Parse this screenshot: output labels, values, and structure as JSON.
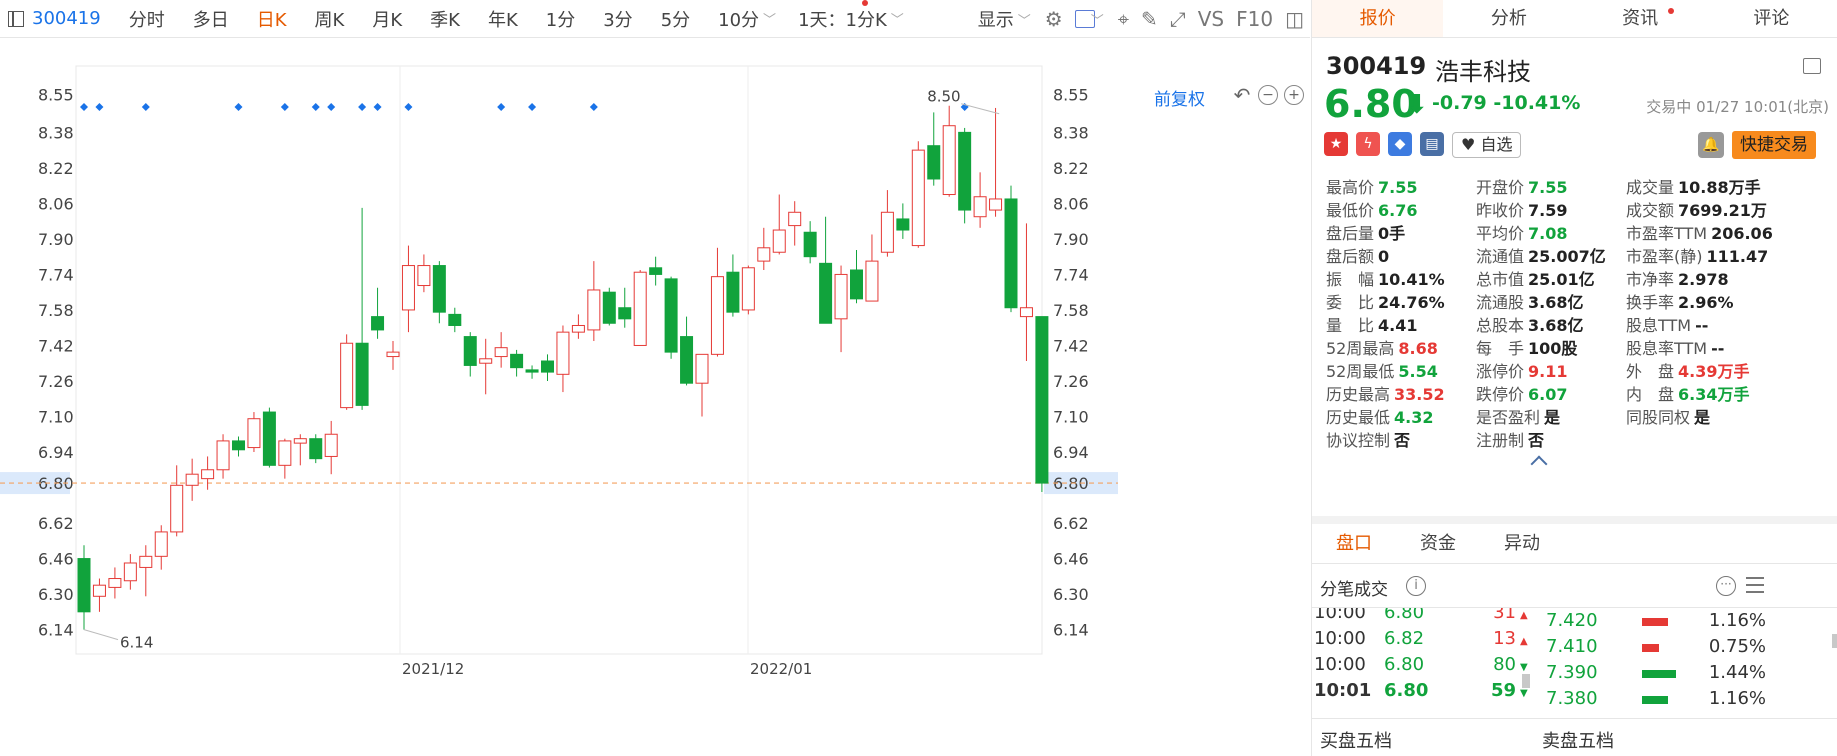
{
  "toolbar": {
    "code": "300419",
    "tabs": [
      "分时",
      "多日",
      "日K",
      "周K",
      "月K",
      "季K",
      "年K",
      "1分",
      "3分",
      "5分",
      "10分"
    ],
    "active_tab": "日K",
    "period_select": "1天：1分K",
    "display_label": "显示",
    "vs_label": "VS",
    "f10_label": "F10"
  },
  "chart_header": {
    "adjust_label": "前复权"
  },
  "chart_data": {
    "type": "candlestick",
    "y_ticks": [
      8.55,
      8.38,
      8.22,
      8.06,
      7.9,
      7.74,
      7.58,
      7.42,
      7.26,
      7.1,
      6.94,
      6.8,
      6.62,
      6.46,
      6.3,
      6.14
    ],
    "y_ticks_labels": [
      "8.55",
      "8.38",
      "8.22",
      "8.06",
      "7.90",
      "7.74",
      "7.58",
      "7.42",
      "7.26",
      "7.10",
      "6.94",
      "6.80",
      "6.62",
      "6.46",
      "6.30",
      "6.14"
    ],
    "ylim": [
      6.03,
      8.67
    ],
    "x_labels": [
      "2021/12",
      "2022/01"
    ],
    "current_price": 6.8,
    "current_price_label": "6.80",
    "max_annotation": {
      "value": 8.5,
      "label": "8.50"
    },
    "min_annotation": {
      "value": 6.14,
      "label": "6.14"
    },
    "candles": [
      {
        "o": 6.46,
        "h": 6.52,
        "l": 6.14,
        "c": 6.22
      },
      {
        "o": 6.29,
        "h": 6.37,
        "l": 6.22,
        "c": 6.34
      },
      {
        "o": 6.33,
        "h": 6.42,
        "l": 6.28,
        "c": 6.37
      },
      {
        "o": 6.36,
        "h": 6.48,
        "l": 6.32,
        "c": 6.44
      },
      {
        "o": 6.42,
        "h": 6.52,
        "l": 6.29,
        "c": 6.47
      },
      {
        "o": 6.47,
        "h": 6.61,
        "l": 6.41,
        "c": 6.58
      },
      {
        "o": 6.58,
        "h": 6.88,
        "l": 6.56,
        "c": 6.79
      },
      {
        "o": 6.79,
        "h": 6.91,
        "l": 6.72,
        "c": 6.84
      },
      {
        "o": 6.82,
        "h": 6.92,
        "l": 6.77,
        "c": 6.86
      },
      {
        "o": 6.86,
        "h": 7.02,
        "l": 6.82,
        "c": 6.99
      },
      {
        "o": 6.99,
        "h": 7.01,
        "l": 6.92,
        "c": 6.95
      },
      {
        "o": 6.96,
        "h": 7.12,
        "l": 6.94,
        "c": 7.09
      },
      {
        "o": 7.12,
        "h": 7.14,
        "l": 6.87,
        "c": 6.88
      },
      {
        "o": 6.88,
        "h": 7.0,
        "l": 6.82,
        "c": 6.99
      },
      {
        "o": 6.98,
        "h": 7.02,
        "l": 6.88,
        "c": 7.0
      },
      {
        "o": 7.0,
        "h": 7.02,
        "l": 6.89,
        "c": 6.91
      },
      {
        "o": 6.92,
        "h": 7.08,
        "l": 6.84,
        "c": 7.02
      },
      {
        "o": 7.14,
        "h": 7.47,
        "l": 7.13,
        "c": 7.43
      },
      {
        "o": 7.43,
        "h": 8.04,
        "l": 7.13,
        "c": 7.15
      },
      {
        "o": 7.55,
        "h": 7.68,
        "l": 7.45,
        "c": 7.49
      },
      {
        "o": 7.37,
        "h": 7.44,
        "l": 7.31,
        "c": 7.39
      },
      {
        "o": 7.58,
        "h": 7.87,
        "l": 7.48,
        "c": 7.78
      },
      {
        "o": 7.69,
        "h": 7.83,
        "l": 7.66,
        "c": 7.78
      },
      {
        "o": 7.78,
        "h": 7.8,
        "l": 7.52,
        "c": 7.57
      },
      {
        "o": 7.56,
        "h": 7.59,
        "l": 7.48,
        "c": 7.51
      },
      {
        "o": 7.46,
        "h": 7.48,
        "l": 7.28,
        "c": 7.33
      },
      {
        "o": 7.34,
        "h": 7.45,
        "l": 7.2,
        "c": 7.36
      },
      {
        "o": 7.37,
        "h": 7.48,
        "l": 7.32,
        "c": 7.41
      },
      {
        "o": 7.38,
        "h": 7.4,
        "l": 7.28,
        "c": 7.32
      },
      {
        "o": 7.31,
        "h": 7.33,
        "l": 7.27,
        "c": 7.3
      },
      {
        "o": 7.35,
        "h": 7.38,
        "l": 7.26,
        "c": 7.3
      },
      {
        "o": 7.29,
        "h": 7.51,
        "l": 7.21,
        "c": 7.48
      },
      {
        "o": 7.48,
        "h": 7.56,
        "l": 7.45,
        "c": 7.51
      },
      {
        "o": 7.49,
        "h": 7.8,
        "l": 7.44,
        "c": 7.67
      },
      {
        "o": 7.66,
        "h": 7.68,
        "l": 7.51,
        "c": 7.52
      },
      {
        "o": 7.59,
        "h": 7.68,
        "l": 7.5,
        "c": 7.54
      },
      {
        "o": 7.42,
        "h": 7.76,
        "l": 7.42,
        "c": 7.75
      },
      {
        "o": 7.77,
        "h": 7.82,
        "l": 7.69,
        "c": 7.74
      },
      {
        "o": 7.72,
        "h": 7.73,
        "l": 7.36,
        "c": 7.39
      },
      {
        "o": 7.46,
        "h": 7.55,
        "l": 7.24,
        "c": 7.25
      },
      {
        "o": 7.25,
        "h": 7.35,
        "l": 7.1,
        "c": 7.38
      },
      {
        "o": 7.38,
        "h": 7.86,
        "l": 7.37,
        "c": 7.73
      },
      {
        "o": 7.75,
        "h": 7.83,
        "l": 7.55,
        "c": 7.57
      },
      {
        "o": 7.58,
        "h": 7.78,
        "l": 7.56,
        "c": 7.77
      },
      {
        "o": 7.8,
        "h": 7.95,
        "l": 7.76,
        "c": 7.86
      },
      {
        "o": 7.84,
        "h": 8.1,
        "l": 7.83,
        "c": 7.94
      },
      {
        "o": 7.96,
        "h": 8.07,
        "l": 7.87,
        "c": 8.02
      },
      {
        "o": 7.93,
        "h": 7.98,
        "l": 7.79,
        "c": 7.82
      },
      {
        "o": 7.79,
        "h": 8.0,
        "l": 7.55,
        "c": 7.52
      },
      {
        "o": 7.54,
        "h": 7.78,
        "l": 7.39,
        "c": 7.74
      },
      {
        "o": 7.76,
        "h": 7.85,
        "l": 7.61,
        "c": 7.63
      },
      {
        "o": 7.62,
        "h": 7.92,
        "l": 7.62,
        "c": 7.8
      },
      {
        "o": 7.84,
        "h": 8.12,
        "l": 7.82,
        "c": 8.02
      },
      {
        "o": 7.99,
        "h": 8.06,
        "l": 7.9,
        "c": 7.94
      },
      {
        "o": 7.87,
        "h": 8.34,
        "l": 7.86,
        "c": 8.3
      },
      {
        "o": 8.32,
        "h": 8.47,
        "l": 8.14,
        "c": 8.17
      },
      {
        "o": 8.1,
        "h": 8.5,
        "l": 8.09,
        "c": 8.41
      },
      {
        "o": 8.38,
        "h": 8.4,
        "l": 7.97,
        "c": 8.03
      },
      {
        "o": 8.0,
        "h": 8.2,
        "l": 7.95,
        "c": 8.09
      },
      {
        "o": 8.03,
        "h": 8.49,
        "l": 8.0,
        "c": 8.08
      },
      {
        "o": 8.08,
        "h": 8.14,
        "l": 7.57,
        "c": 7.59
      },
      {
        "o": 7.55,
        "h": 7.97,
        "l": 7.35,
        "c": 7.59
      },
      {
        "o": 7.55,
        "h": 7.55,
        "l": 6.76,
        "c": 6.8
      }
    ],
    "event_markers": [
      0,
      1,
      4,
      10,
      13,
      15,
      16,
      18,
      19,
      21,
      27,
      29,
      33,
      57
    ]
  },
  "panel": {
    "tabs": [
      "报价",
      "分析",
      "资讯",
      "评论"
    ],
    "active_tab": "报价",
    "code": "300419",
    "name": "浩丰科技",
    "price": "6.80",
    "change": "-0.79",
    "change_pct": "-10.41%",
    "trade_time": "交易中 01/27 10:01(北京)",
    "fav_label": "自选",
    "quick_trade": "快捷交易",
    "quotes": [
      {
        "k": "最高价",
        "v": "7.55",
        "c": "green"
      },
      {
        "k": "开盘价",
        "v": "7.55",
        "c": "green"
      },
      {
        "k": "成交量",
        "v": "10.88万手",
        "c": "dark"
      },
      {
        "k": "最低价",
        "v": "6.76",
        "c": "green"
      },
      {
        "k": "昨收价",
        "v": "7.59",
        "c": "dark"
      },
      {
        "k": "成交额",
        "v": "7699.21万",
        "c": "dark"
      },
      {
        "k": "盘后量",
        "v": "0手",
        "c": "dark"
      },
      {
        "k": "平均价",
        "v": "7.08",
        "c": "green"
      },
      {
        "k": "市盈率TTM",
        "v": "206.06",
        "c": "dark"
      },
      {
        "k": "盘后额",
        "v": "0",
        "c": "dark"
      },
      {
        "k": "流通值",
        "v": "25.007亿",
        "c": "dark"
      },
      {
        "k": "市盈率(静)",
        "v": "111.47",
        "c": "dark"
      },
      {
        "k": "振　幅",
        "v": "10.41%",
        "c": "dark"
      },
      {
        "k": "总市值",
        "v": "25.01亿",
        "c": "dark"
      },
      {
        "k": "市净率",
        "v": "2.978",
        "c": "dark"
      },
      {
        "k": "委　比",
        "v": "24.76%",
        "c": "dark"
      },
      {
        "k": "流通股",
        "v": "3.68亿",
        "c": "dark"
      },
      {
        "k": "换手率",
        "v": "2.96%",
        "c": "dark"
      },
      {
        "k": "量　比",
        "v": "4.41",
        "c": "dark"
      },
      {
        "k": "总股本",
        "v": "3.68亿",
        "c": "dark"
      },
      {
        "k": "股息TTM",
        "v": "--",
        "c": "dark"
      },
      {
        "k": "52周最高",
        "v": "8.68",
        "c": "red"
      },
      {
        "k": "每　手",
        "v": "100股",
        "c": "dark"
      },
      {
        "k": "股息率TTM",
        "v": "--",
        "c": "dark"
      },
      {
        "k": "52周最低",
        "v": "5.54",
        "c": "green"
      },
      {
        "k": "涨停价",
        "v": "9.11",
        "c": "red"
      },
      {
        "k": "外　盘",
        "v": "4.39万手",
        "c": "red"
      },
      {
        "k": "历史最高",
        "v": "33.52",
        "c": "red"
      },
      {
        "k": "跌停价",
        "v": "6.07",
        "c": "green"
      },
      {
        "k": "内　盘",
        "v": "6.34万手",
        "c": "green"
      },
      {
        "k": "历史最低",
        "v": "4.32",
        "c": "green"
      },
      {
        "k": "是否盈利",
        "v": "是",
        "c": "dark"
      },
      {
        "k": "同股同权",
        "v": "是",
        "c": "dark"
      },
      {
        "k": "协议控制",
        "v": "否",
        "c": "dark"
      },
      {
        "k": "注册制",
        "v": "否",
        "c": "dark"
      }
    ],
    "subtabs": [
      "盘口",
      "资金",
      "异动"
    ],
    "active_subtab": "盘口",
    "ticks_title": "分笔成交",
    "ticks": [
      {
        "t": "10:00",
        "p": "6.80",
        "v": "31",
        "dir": "up"
      },
      {
        "t": "10:00",
        "p": "6.82",
        "v": "13",
        "dir": "up"
      },
      {
        "t": "10:00",
        "p": "6.80",
        "v": "80",
        "dir": "down"
      },
      {
        "t": "10:01",
        "p": "6.80",
        "v": "59",
        "dir": "down"
      }
    ],
    "dist": [
      {
        "p": "7.420",
        "pct": "1.16%",
        "w": 0.55,
        "c": "#e53935"
      },
      {
        "p": "7.410",
        "pct": "0.75%",
        "w": 0.35,
        "c": "#e53935"
      },
      {
        "p": "7.390",
        "pct": "1.44%",
        "w": 0.7,
        "c": "#11a33c"
      },
      {
        "p": "7.380",
        "pct": "1.16%",
        "w": 0.55,
        "c": "#11a33c"
      }
    ],
    "buy_book": "买盘五档",
    "sell_book": "卖盘五档"
  },
  "colors": {
    "up": "#e53935",
    "down": "#11a33c",
    "accent": "#e55a00",
    "link": "#1a73e8"
  }
}
